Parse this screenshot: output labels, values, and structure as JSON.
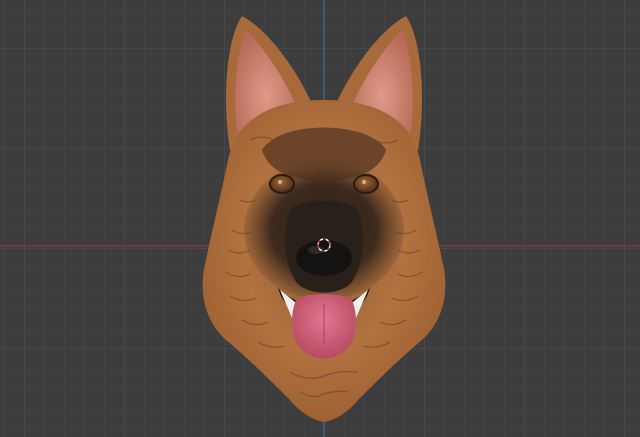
{
  "viewport": {
    "background": "#3d3d3d",
    "grid_minor": "#444444",
    "grid_major": "#4a4a4a",
    "axis_x_color": "#8a3a46",
    "axis_y_color": "#3d6a9a"
  },
  "model": {
    "subject": "german-shepherd-head-sculpt",
    "fur_color": "#b0703c",
    "fur_dark": "#3a2a20",
    "ear_inner": "#d98a7a",
    "tongue": "#d0607a",
    "nose": "#141414",
    "eye": "#7a4a28"
  },
  "cursor": {
    "icon": "3d-cursor-icon",
    "color_a": "#ffffff",
    "color_b": "#d04040"
  }
}
